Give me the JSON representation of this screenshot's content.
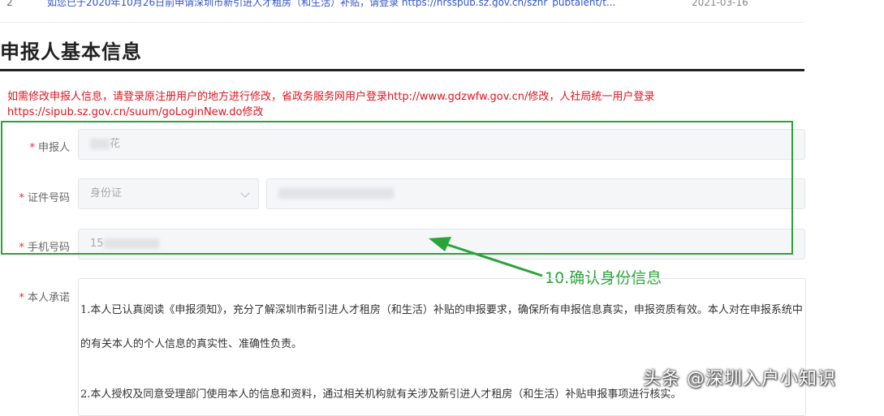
{
  "notice": {
    "index": "2",
    "text": "如您已于2020年10月26日前申请深圳市新引进人才租房（和生活）补贴，请登录 https://hrsspub.sz.gov.cn/sznr_pubtalent/t...",
    "date": "2021-03-16"
  },
  "section": {
    "title": "申报人基本信息"
  },
  "tip": {
    "text": "如需修改申报人信息，请登录原注册用户的地方进行修改，省政务服务网用户登录http://www.gdzwfw.gov.cn/修改，人社局统一用户登录https://sipub.sz.gov.cn/suum/goLoginNew.do修改"
  },
  "form": {
    "required_mark": "*",
    "applicant": {
      "label": "申报人",
      "value_visible": "花"
    },
    "id_number": {
      "label": "证件号码",
      "type_value": "身份证"
    },
    "phone": {
      "label": "手机号码",
      "value_visible": "15"
    },
    "pledge": {
      "label": "本人承诺",
      "paragraphs": [
        "1.本人已认真阅读《申报须知》，充分了解深圳市新引进人才租房（和生活）补贴的申报要求，确保所有申报信息真实，申报资质有效。本人对在申报系统中的有关本人的个人信息的真实性、准确性负责。",
        "2.本人授权及同意受理部门使用本人的信息和资料，通过相关机构就有关涉及新引进人才租房（和生活）补贴申报事项进行核实。"
      ]
    }
  },
  "annotation": {
    "text": "10.确认身份信息",
    "color": "#2aa33a"
  },
  "watermark": {
    "text": "头条 @深圳入户小知识"
  },
  "colors": {
    "accent_green": "#2aa33a",
    "warning_red": "#e0141e",
    "link_blue": "#2f54c8"
  }
}
